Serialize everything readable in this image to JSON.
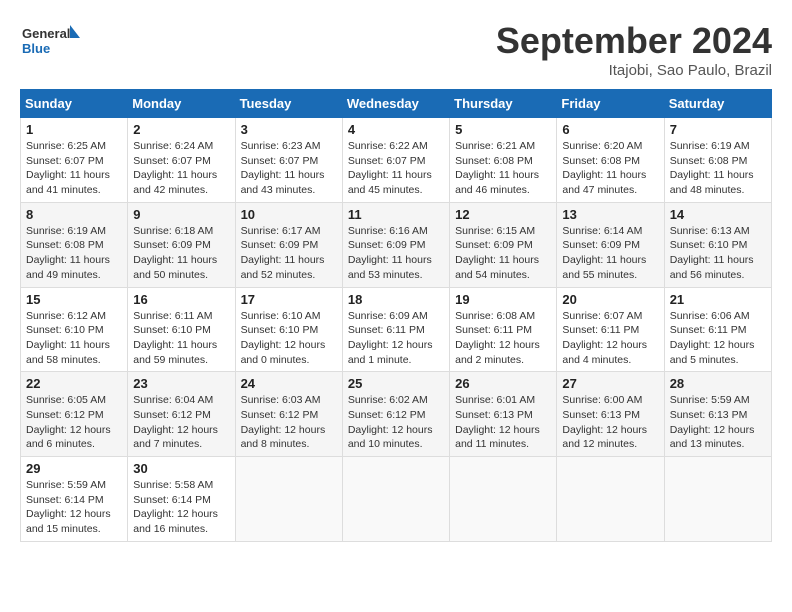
{
  "header": {
    "logo_line1": "General",
    "logo_line2": "Blue",
    "month": "September 2024",
    "location": "Itajobi, Sao Paulo, Brazil"
  },
  "weekdays": [
    "Sunday",
    "Monday",
    "Tuesday",
    "Wednesday",
    "Thursday",
    "Friday",
    "Saturday"
  ],
  "weeks": [
    [
      {
        "day": "1",
        "sunrise": "6:25 AM",
        "sunset": "6:07 PM",
        "daylight": "11 hours and 41 minutes."
      },
      {
        "day": "2",
        "sunrise": "6:24 AM",
        "sunset": "6:07 PM",
        "daylight": "11 hours and 42 minutes."
      },
      {
        "day": "3",
        "sunrise": "6:23 AM",
        "sunset": "6:07 PM",
        "daylight": "11 hours and 43 minutes."
      },
      {
        "day": "4",
        "sunrise": "6:22 AM",
        "sunset": "6:07 PM",
        "daylight": "11 hours and 45 minutes."
      },
      {
        "day": "5",
        "sunrise": "6:21 AM",
        "sunset": "6:08 PM",
        "daylight": "11 hours and 46 minutes."
      },
      {
        "day": "6",
        "sunrise": "6:20 AM",
        "sunset": "6:08 PM",
        "daylight": "11 hours and 47 minutes."
      },
      {
        "day": "7",
        "sunrise": "6:19 AM",
        "sunset": "6:08 PM",
        "daylight": "11 hours and 48 minutes."
      }
    ],
    [
      {
        "day": "8",
        "sunrise": "6:19 AM",
        "sunset": "6:08 PM",
        "daylight": "11 hours and 49 minutes."
      },
      {
        "day": "9",
        "sunrise": "6:18 AM",
        "sunset": "6:09 PM",
        "daylight": "11 hours and 50 minutes."
      },
      {
        "day": "10",
        "sunrise": "6:17 AM",
        "sunset": "6:09 PM",
        "daylight": "11 hours and 52 minutes."
      },
      {
        "day": "11",
        "sunrise": "6:16 AM",
        "sunset": "6:09 PM",
        "daylight": "11 hours and 53 minutes."
      },
      {
        "day": "12",
        "sunrise": "6:15 AM",
        "sunset": "6:09 PM",
        "daylight": "11 hours and 54 minutes."
      },
      {
        "day": "13",
        "sunrise": "6:14 AM",
        "sunset": "6:09 PM",
        "daylight": "11 hours and 55 minutes."
      },
      {
        "day": "14",
        "sunrise": "6:13 AM",
        "sunset": "6:10 PM",
        "daylight": "11 hours and 56 minutes."
      }
    ],
    [
      {
        "day": "15",
        "sunrise": "6:12 AM",
        "sunset": "6:10 PM",
        "daylight": "11 hours and 58 minutes."
      },
      {
        "day": "16",
        "sunrise": "6:11 AM",
        "sunset": "6:10 PM",
        "daylight": "11 hours and 59 minutes."
      },
      {
        "day": "17",
        "sunrise": "6:10 AM",
        "sunset": "6:10 PM",
        "daylight": "12 hours and 0 minutes."
      },
      {
        "day": "18",
        "sunrise": "6:09 AM",
        "sunset": "6:11 PM",
        "daylight": "12 hours and 1 minute."
      },
      {
        "day": "19",
        "sunrise": "6:08 AM",
        "sunset": "6:11 PM",
        "daylight": "12 hours and 2 minutes."
      },
      {
        "day": "20",
        "sunrise": "6:07 AM",
        "sunset": "6:11 PM",
        "daylight": "12 hours and 4 minutes."
      },
      {
        "day": "21",
        "sunrise": "6:06 AM",
        "sunset": "6:11 PM",
        "daylight": "12 hours and 5 minutes."
      }
    ],
    [
      {
        "day": "22",
        "sunrise": "6:05 AM",
        "sunset": "6:12 PM",
        "daylight": "12 hours and 6 minutes."
      },
      {
        "day": "23",
        "sunrise": "6:04 AM",
        "sunset": "6:12 PM",
        "daylight": "12 hours and 7 minutes."
      },
      {
        "day": "24",
        "sunrise": "6:03 AM",
        "sunset": "6:12 PM",
        "daylight": "12 hours and 8 minutes."
      },
      {
        "day": "25",
        "sunrise": "6:02 AM",
        "sunset": "6:12 PM",
        "daylight": "12 hours and 10 minutes."
      },
      {
        "day": "26",
        "sunrise": "6:01 AM",
        "sunset": "6:13 PM",
        "daylight": "12 hours and 11 minutes."
      },
      {
        "day": "27",
        "sunrise": "6:00 AM",
        "sunset": "6:13 PM",
        "daylight": "12 hours and 12 minutes."
      },
      {
        "day": "28",
        "sunrise": "5:59 AM",
        "sunset": "6:13 PM",
        "daylight": "12 hours and 13 minutes."
      }
    ],
    [
      {
        "day": "29",
        "sunrise": "5:59 AM",
        "sunset": "6:14 PM",
        "daylight": "12 hours and 15 minutes."
      },
      {
        "day": "30",
        "sunrise": "5:58 AM",
        "sunset": "6:14 PM",
        "daylight": "12 hours and 16 minutes."
      },
      null,
      null,
      null,
      null,
      null
    ]
  ],
  "labels": {
    "sunrise": "Sunrise:",
    "sunset": "Sunset:",
    "daylight": "Daylight:"
  }
}
